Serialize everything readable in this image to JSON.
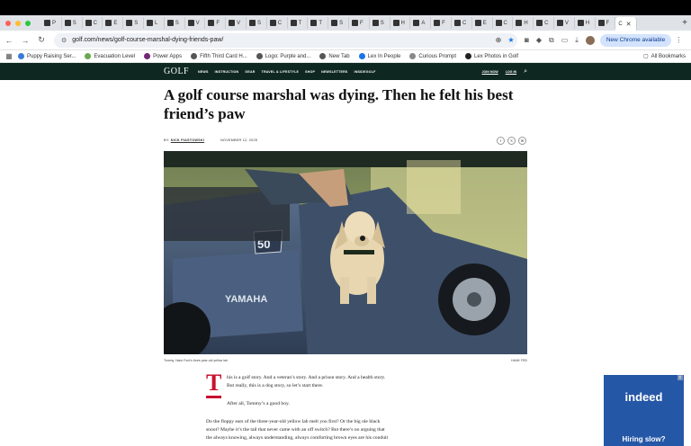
{
  "browser": {
    "tabs": [
      {
        "label": "P",
        "icon": "tab-favicon"
      },
      {
        "label": "S",
        "icon": "tab-favicon"
      },
      {
        "label": "C",
        "icon": "tab-favicon"
      },
      {
        "label": "E",
        "icon": "tab-favicon"
      },
      {
        "label": "S",
        "icon": "tab-favicon"
      },
      {
        "label": "L",
        "icon": "tab-favicon"
      },
      {
        "label": "S",
        "icon": "tab-favicon"
      },
      {
        "label": "V",
        "icon": "tab-favicon"
      },
      {
        "label": "F",
        "icon": "tab-favicon"
      },
      {
        "label": "V",
        "icon": "tab-favicon"
      },
      {
        "label": "S",
        "icon": "tab-favicon"
      },
      {
        "label": "C",
        "icon": "tab-favicon"
      },
      {
        "label": "T",
        "icon": "tab-favicon"
      },
      {
        "label": "T",
        "icon": "tab-favicon"
      },
      {
        "label": "S",
        "icon": "tab-favicon"
      },
      {
        "label": "F",
        "icon": "tab-favicon"
      },
      {
        "label": "S",
        "icon": "tab-favicon"
      },
      {
        "label": "H",
        "icon": "tab-favicon"
      },
      {
        "label": "A",
        "icon": "tab-favicon"
      },
      {
        "label": "F",
        "icon": "tab-favicon"
      },
      {
        "label": "C",
        "icon": "tab-favicon"
      },
      {
        "label": "E",
        "icon": "tab-favicon"
      },
      {
        "label": "C",
        "icon": "tab-favicon"
      },
      {
        "label": "H",
        "icon": "tab-favicon"
      },
      {
        "label": "C",
        "icon": "tab-favicon"
      },
      {
        "label": "V",
        "icon": "tab-favicon"
      },
      {
        "label": "H",
        "icon": "tab-favicon"
      },
      {
        "label": "F",
        "icon": "tab-favicon"
      }
    ],
    "active_tab": {
      "label": "C",
      "close": "✕"
    },
    "new_tab": "+",
    "url": "golf.com/news/golf-course-marshal-dying-friends-paw/",
    "new_chrome_label": "New Chrome available",
    "bookmarks": [
      {
        "label": "Puppy Raising Ser...",
        "color": "#3a7bd5"
      },
      {
        "label": "Evacuation Level",
        "color": "#6aa84f"
      },
      {
        "label": "Power Apps",
        "color": "#742774"
      },
      {
        "label": "Fifth Third Card H...",
        "color": "#555555"
      },
      {
        "label": "Logo: Purple and...",
        "color": "#555555"
      },
      {
        "label": "New Tab",
        "color": "#555555"
      },
      {
        "label": "Lex In People",
        "color": "#1a73e8"
      },
      {
        "label": "Curious Prompt",
        "color": "#888888"
      },
      {
        "label": "Lex Photos in Golf",
        "color": "#222222"
      }
    ],
    "all_bookmarks": "All Bookmarks"
  },
  "site": {
    "logo": "GOLF",
    "nav": [
      "NEWS",
      "INSTRUCTION",
      "GEAR",
      "TRAVEL & LIFESTYLE",
      "SHOP",
      "NEWSLETTERS",
      "INSIDEGOLF"
    ],
    "join": "JOIN NOW",
    "login": "LOG IN"
  },
  "article": {
    "headline": "A golf course marshal was dying. Then he felt his best friend’s paw",
    "byline_prefix": "BY:",
    "author": "NICK PIASTOWSKI",
    "date": "NOVEMBER 12, 2025",
    "share_icons": [
      "f",
      "𝕏",
      "✉"
    ],
    "caption": "Tommy, Hank Ford's three-year-old yellow lab.",
    "credit": "HANK FRD",
    "cart_number": "50",
    "cart_brand": "YAMAHA",
    "dropcap": "T",
    "para1": "his is a golf story. And a veteran’s story. And a prison story. And a health story. But really, this is a dog story, so let’s start there.",
    "para2": "After all, Tommy’s a good boy.",
    "para3": "Do the floppy ears of the three-year-old yellow lab melt you first? Or the big ole black snoot? Maybe it’s the tail that never came with an off switch? But there’s no arguing that the always knowing, always understanding, always comforting brown eyes are his conduit"
  },
  "ad": {
    "close": "x",
    "logo": "indeed",
    "tagline": "Hiring slow?"
  }
}
